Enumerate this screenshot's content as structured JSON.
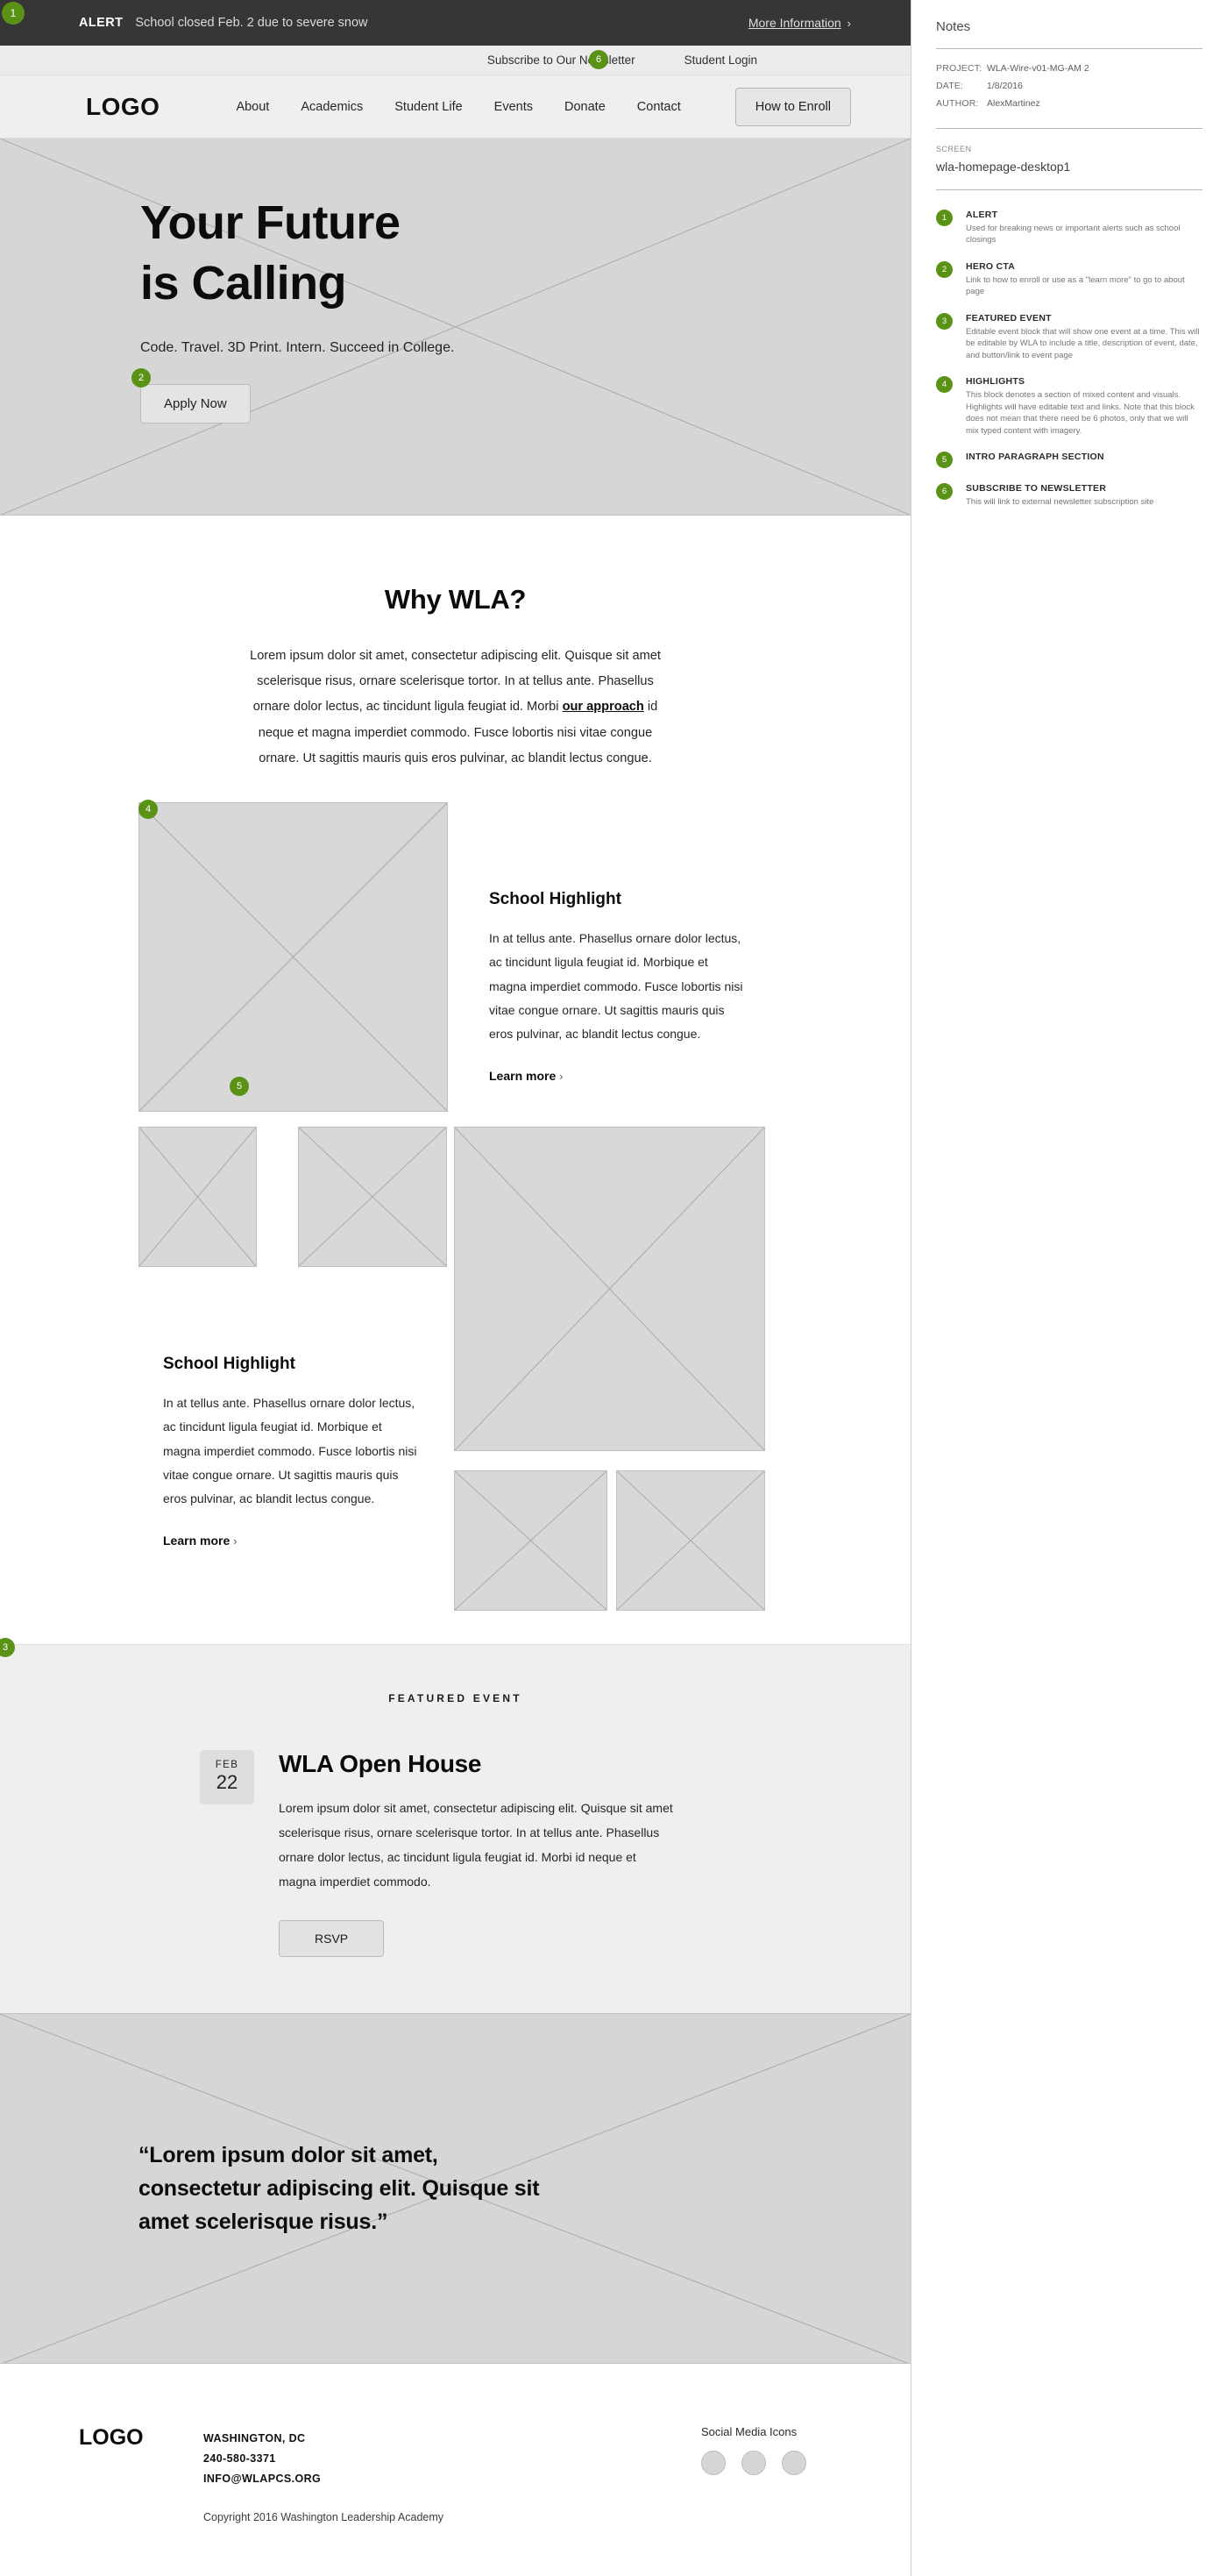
{
  "theme": {
    "marker_green": "#5a9216",
    "alert_bg": "#363636",
    "placeholder_gray": "#d8d8d8"
  },
  "alert": {
    "label": "ALERT",
    "message": "School closed Feb. 2 due to severe snow",
    "more_link": "More Information",
    "chevron": "›"
  },
  "utility": {
    "newsletter": "Subscribe to Our Newsletter",
    "student_login": "Student Login"
  },
  "nav": {
    "logo": "LOGO",
    "links": [
      "About",
      "Academics",
      "Student Life",
      "Events",
      "Donate",
      "Contact"
    ],
    "cta": "How to Enroll"
  },
  "hero": {
    "title_line1": "Your Future",
    "title_line2": "is Calling",
    "subtitle": "Code. Travel. 3D Print. Intern. Succeed in College.",
    "cta": "Apply Now"
  },
  "why": {
    "title": "Why WLA?",
    "body_before": "Lorem ipsum dolor sit amet, consectetur adipiscing elit. Quisque sit amet scelerisque risus, ornare scelerisque tortor. In at tellus ante. Phasellus ornare dolor lectus, ac tincidunt ligula feugiat id. Morbi ",
    "body_link": "our approach",
    "body_after": " id neque et magna imperdiet commodo. Fusce lobortis nisi vitae congue ornare. Ut sagittis mauris quis eros pulvinar, ac blandit lectus congue."
  },
  "highlights": [
    {
      "heading": "School Highlight",
      "body": "In at tellus ante. Phasellus ornare dolor lectus, ac tincidunt ligula feugiat id. Morbique et magna imperdiet commodo. Fusce lobortis nisi vitae congue ornare. Ut sagittis mauris quis eros pulvinar, ac blandit lectus congue.",
      "link": "Learn more",
      "chevron": "›"
    },
    {
      "heading": "School Highlight",
      "body": "In at tellus ante. Phasellus ornare dolor lectus, ac tincidunt ligula feugiat id. Morbique et magna imperdiet commodo. Fusce lobortis nisi vitae congue ornare. Ut sagittis mauris quis eros pulvinar, ac blandit lectus congue.",
      "link": "Learn more",
      "chevron": "›"
    }
  ],
  "featured_event": {
    "kicker": "FEATURED EVENT",
    "date_month": "FEB",
    "date_day": "22",
    "title": "WLA Open House",
    "body": "Lorem ipsum dolor sit amet, consectetur adipiscing elit. Quisque sit amet scelerisque risus, ornare scelerisque tortor. In at tellus ante. Phasellus ornare dolor lectus, ac tincidunt ligula feugiat id. Morbi id neque et magna imperdiet commodo.",
    "cta": "RSVP"
  },
  "quote": {
    "text": "“Lorem ipsum dolor sit amet, consectetur adipiscing elit. Quisque sit amet scelerisque risus.”"
  },
  "footer": {
    "logo": "LOGO",
    "city": "WASHINGTON, DC",
    "phone": "240-580-3371",
    "email": "INFO@WLAPCS.ORG",
    "copyright": "Copyright 2016 Washington Leadership Academy",
    "social_label": "Social Media Icons"
  },
  "markers": {
    "alert": "1",
    "hero_cta": "2",
    "featured_event": "3",
    "highlights": "4",
    "intro": "5",
    "newsletter": "6"
  },
  "notes": {
    "title": "Notes",
    "meta": [
      {
        "key": "PROJECT:",
        "value": "WLA-Wire-v01-MG-AM 2"
      },
      {
        "key": "DATE:",
        "value": "1/8/2016"
      },
      {
        "key": "AUTHOR:",
        "value": "AlexMartinez"
      }
    ],
    "screen_key": "SCREEN",
    "screen_value": "wla-homepage-desktop1",
    "items": [
      {
        "num": "1",
        "heading": "ALERT",
        "body": "Used for breaking news or important alerts such as school closings"
      },
      {
        "num": "2",
        "heading": "HERO CTA",
        "body": "Link to how to enroll or use as a \"learn more\" to go to about page"
      },
      {
        "num": "3",
        "heading": "FEATURED EVENT",
        "body": "Editable event block that will show one event at a time. This will be editable by WLA to include a title, description of event, date, and button/link to event page"
      },
      {
        "num": "4",
        "heading": "HIGHLIGHTS",
        "body": "This block denotes a section of mixed content and visuals. Highlights will have editable text and links. Note that this block does not mean that there need be 6 photos, only that we will mix typed content with imagery."
      },
      {
        "num": "5",
        "heading": "INTRO PARAGRAPH SECTION",
        "body": ""
      },
      {
        "num": "6",
        "heading": "SUBSCRIBE TO NEWSLETTER",
        "body": "This will link to external newsletter subscription site"
      }
    ]
  }
}
